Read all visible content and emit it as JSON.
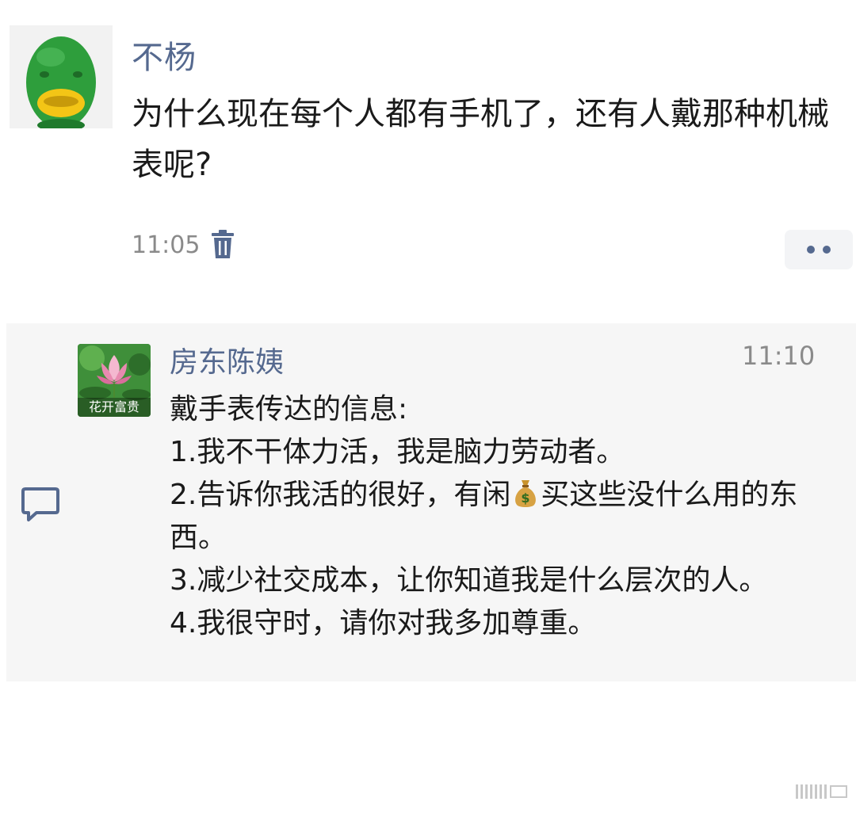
{
  "post": {
    "author": "不杨",
    "text": "为什么现在每个人都有手机了，还有人戴那种机械表呢?",
    "time": "11:05",
    "avatar_icon": "green-fish-mask-avatar",
    "delete_icon": "trash-icon",
    "more_icon": "more-dots-icon"
  },
  "comment": {
    "author": "房东陈姨",
    "time": "11:10",
    "avatar_caption": "花开富贵",
    "avatar_icon": "lotus-flower-avatar",
    "comment_icon": "comment-bubble-icon",
    "lines": {
      "l0": "戴手表传达的信息:",
      "l1": "1.我不干体力活，我是脑力劳动者。",
      "l2_before": "2.告诉你我活的很好，有闲",
      "l2_after": "买这些没什么用的东西。",
      "l3": "3.减少社交成本，让你知道我是什么层次的人。",
      "l4": "4.我很守时，请你对我多加尊重。"
    },
    "emoji_icon": "money-bag-icon"
  },
  "colors": {
    "name_blue": "#55698f",
    "time_gray": "#8a8a8a",
    "panel_bg": "#f6f6f6"
  }
}
